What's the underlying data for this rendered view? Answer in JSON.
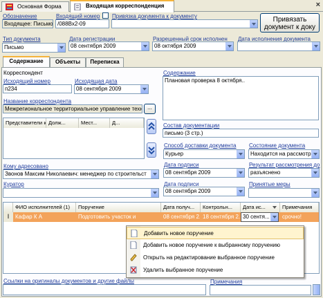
{
  "tabs": [
    {
      "label": "Основная Форма"
    },
    {
      "label": "Входящая корреспонденция"
    }
  ],
  "close_glyph": "×",
  "header": {
    "designation_label": "Обозначение",
    "designation_value": "Входящее: Письмо",
    "incoming_no_label": "Входящий номер",
    "incoming_no_value": "/088Вх2-09",
    "binding_label": "Привязка документа к документу",
    "bind_button": "Привязать документ к доку"
  },
  "row2": {
    "doctype_label": "Тип документа",
    "doctype_value": "Письмо",
    "regdate_label": "Дата регистрации",
    "regdate_value": "08 сентября 2009",
    "deadline_label": "Разрешенный срок исполнен",
    "deadline_value": "08 октября 2009",
    "execdate_label": "Дата исполнения документа",
    "execdate_value": ""
  },
  "subtabs": [
    {
      "label": "Содержание"
    },
    {
      "label": "Объекты"
    },
    {
      "label": "Переписка"
    }
  ],
  "left": {
    "correspondent_title": "Корреспондент",
    "outno_label": "Исходящий номер",
    "outno_value": "п234",
    "outdate_label": "Исходящая дата",
    "outdate_value": "08 сентября 2009",
    "corrname_label": "Название корреспондента",
    "corrname_value": "Межрегиональное территориальное управление техн",
    "ellipsis": "...",
    "reps_columns": [
      "Представители к...",
      "Долж...",
      "Мест...",
      "Д..."
    ],
    "addressed_label": "Кому адресовано",
    "addressed_value": "Звонов Максим Николаевич: менеджер по строительст",
    "curator_label": "Куратор",
    "curator_value": ""
  },
  "right": {
    "content_label": "Содержание",
    "content_value": "Плановая проверка 8 октября..",
    "composition_label": "Состав документации",
    "composition_value": "письмо (3 стр.)",
    "delivery_label": "Способ доставки документа",
    "delivery_value": "Курьер",
    "state_label": "Состояние документа",
    "state_value": "Находится на рассмотр",
    "sign1_label": "Дата подписи",
    "sign1_value": "08 сентября 2009",
    "result_label": "Результат рассмотрения до",
    "result_value": "разъяснено",
    "sign2_label": "Дата подписи",
    "sign2_value": "08 сентября 2009",
    "measures_label": "Принятые меры",
    "measures_value": ""
  },
  "orders": {
    "columns": [
      "ФИО исполнителей (1)",
      "Поручение",
      "Дата получ...",
      "Контрольн...",
      "Дата ис...",
      "Примечания"
    ],
    "rows": [
      [
        "Кафар К А",
        "Подготовить участок и",
        "08 сентября 2...",
        "18 сентября 2...",
        "30 сентя...",
        "срочно!"
      ]
    ]
  },
  "context_menu": [
    {
      "label": "Добавить новое поручение",
      "icon": "new-doc-icon"
    },
    {
      "label": "Добавить новое поручение к выбранному поручению",
      "icon": "new-doc-icon"
    },
    {
      "label": "Открыть на редактирование выбранное поручение",
      "icon": "edit-icon"
    },
    {
      "label": "Удалить выбранное поручение",
      "icon": "delete-icon"
    }
  ],
  "bottom": {
    "links_label": "Ссылки на оригиналы документов и другие файлы",
    "notes_label": "Примечания"
  },
  "colors": {
    "accent": "#f5b33a",
    "selected_row": "#f3a35a",
    "link": "#1f3c9c"
  }
}
